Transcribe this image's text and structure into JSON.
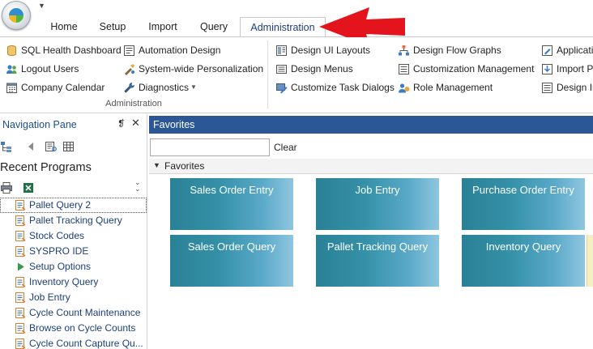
{
  "tabs": [
    {
      "label": "Home"
    },
    {
      "label": "Setup"
    },
    {
      "label": "Import"
    },
    {
      "label": "Query"
    },
    {
      "label": "Administration",
      "active": true
    }
  ],
  "ribbon": {
    "col1": [
      {
        "label": "SQL Health Dashboard",
        "icon": "database-icon"
      },
      {
        "label": "Logout Users",
        "icon": "users-icon"
      },
      {
        "label": "Company Calendar",
        "icon": "calendar-icon"
      }
    ],
    "col2": [
      {
        "label": "Automation Design",
        "icon": "automation-icon"
      },
      {
        "label": "System-wide Personalization",
        "icon": "personalization-icon"
      },
      {
        "label": "Diagnostics",
        "icon": "wrench-icon",
        "dropdown": true
      }
    ],
    "group_label": "Administration",
    "col3": [
      {
        "label": "Design UI Layouts",
        "icon": "layout-icon"
      },
      {
        "label": "Design Menus",
        "icon": "menu-icon"
      },
      {
        "label": "Customize Task Dialogs",
        "icon": "dialog-icon"
      }
    ],
    "col4": [
      {
        "label": "Design Flow Graphs",
        "icon": "flow-graph-icon"
      },
      {
        "label": "Customization Management",
        "icon": "customization-icon"
      },
      {
        "label": "Role Management",
        "icon": "role-icon"
      }
    ],
    "col5": [
      {
        "label": "Applicati",
        "icon": "application-icon"
      },
      {
        "label": "Import P",
        "icon": "import-icon"
      },
      {
        "label": "Design In",
        "icon": "design-icon"
      }
    ]
  },
  "nav": {
    "title": "Navigation Pane",
    "pin_glyph": "❡",
    "close_glyph": "✕",
    "recent_title": "Recent Programs",
    "items": [
      {
        "label": "Pallet Query 2",
        "icon": "program-icon",
        "selected": true
      },
      {
        "label": "Pallet Tracking Query",
        "icon": "program-icon"
      },
      {
        "label": "Stock Codes",
        "icon": "program-icon"
      },
      {
        "label": "SYSPRO IDE",
        "icon": "program-icon"
      },
      {
        "label": "Setup Options",
        "icon": "play-icon"
      },
      {
        "label": "Inventory Query",
        "icon": "program-icon"
      },
      {
        "label": "Job Entry",
        "icon": "program-icon"
      },
      {
        "label": "Cycle Count Maintenance",
        "icon": "program-icon"
      },
      {
        "label": "Browse on Cycle Counts",
        "icon": "program-icon"
      },
      {
        "label": "Cycle Count Capture Qu...",
        "icon": "program-icon"
      }
    ]
  },
  "favorites": {
    "header": "Favorites",
    "search_value": "",
    "clear_label": "Clear",
    "group_label": "Favorites",
    "tiles": [
      {
        "label": "Sales Order Entry"
      },
      {
        "label": "Job Entry"
      },
      {
        "label": "Purchase Order Entry"
      },
      {
        "label": "Sales Order Query"
      },
      {
        "label": "Pallet Tracking Query"
      },
      {
        "label": "Inventory Query"
      }
    ]
  },
  "colors": {
    "accent_header": "#2b5797",
    "tile_gradient_start": "#2a8196",
    "tile_gradient_end": "#8fc6e0",
    "annotation_arrow": "#e3141b",
    "nav_link": "#1a3f7a"
  }
}
